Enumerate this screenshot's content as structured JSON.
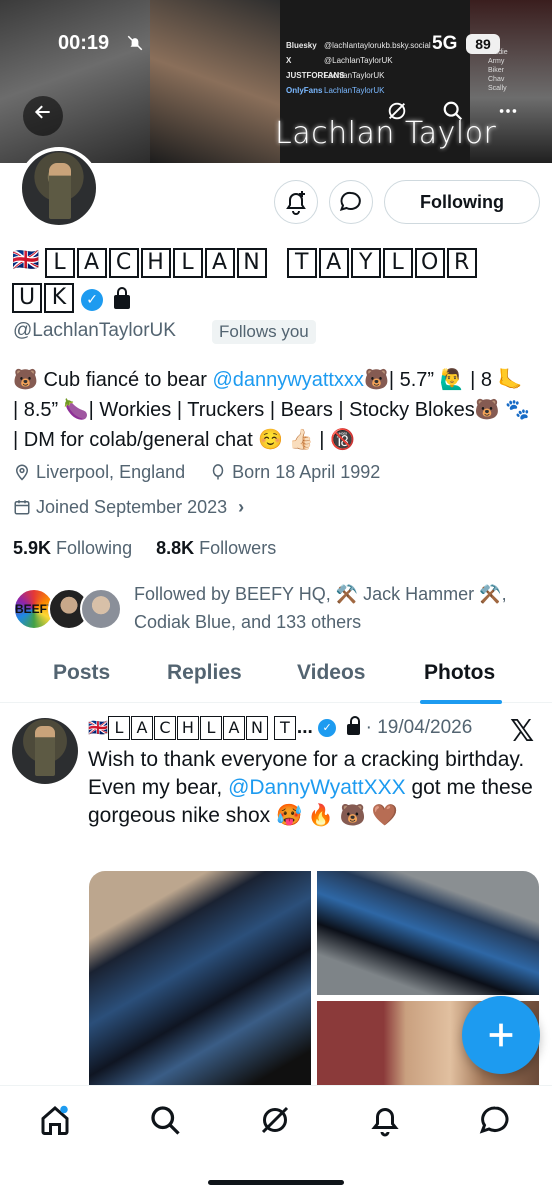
{
  "status_bar": {
    "time": "00:19",
    "network": "5G",
    "battery": "89"
  },
  "banner": {
    "title": "Lachlan Taylor",
    "socials": [
      {
        "tag": "Bluesky",
        "handle": "@lachlantaylorukb.bsky.social"
      },
      {
        "tag": "X",
        "handle": "@LachlanTaylorUK"
      },
      {
        "tag": "JUSTFORFANS",
        "handle": "LachlanTaylorUK"
      },
      {
        "tag": "OnlyFans",
        "handle": "LachlanTaylorUK"
      }
    ],
    "side_words": [
      "Tradie",
      "Army",
      "Biker",
      "Chav",
      "Scally"
    ]
  },
  "profile": {
    "name_letters_line1": [
      "L",
      "A",
      "C",
      "H",
      "L",
      "A",
      "N"
    ],
    "name_letters_line1b": [
      "T",
      "A",
      "Y",
      "L",
      "O",
      "R"
    ],
    "name_letters_line2": [
      "U",
      "K"
    ],
    "flag": "🇬🇧",
    "handle": "@LachlanTaylorUK",
    "follows_you": "Follows you",
    "follow_button": "Following",
    "bio_part1": "🐻 Cub fiancé to bear ",
    "bio_link": "@dannywyattxxx",
    "bio_part2": "🐻| 5.7” 🙋‍♂️ | 8 🦶 | 8.5” 🍆| Workies | Truckers | Bears | Stocky Blokes🐻 🐾 | DM for colab/general chat ☺️ 👍🏻 | 🔞",
    "location": "Liverpool, England",
    "born": "Born 18 April 1992",
    "joined": "Joined September 2023",
    "following_count": "5.9K",
    "following_label": "Following",
    "followers_count": "8.8K",
    "followers_label": "Followers",
    "followed_by": "Followed by BEEFY HQ, ⚒️ Jack Hammer ⚒️, Codiak Blue, and 133 others",
    "beefy_label": "BEEFY"
  },
  "tabs": [
    "Posts",
    "Replies",
    "Videos",
    "Photos"
  ],
  "active_tab": "Photos",
  "post": {
    "author_letters": [
      "L",
      "A",
      "C",
      "H",
      "L",
      "A",
      "N"
    ],
    "author_trunc_letter": "T",
    "ellipsis": "...",
    "date": "· 19/04/2026",
    "text_part1": "Wish to thank everyone for a cracking birthday. Even my bear, ",
    "text_link": "@DannyWyattXXX",
    "text_part2": " got me these gorgeous nike shox 🥵 🔥 🐻 🤎"
  },
  "colors": {
    "accent": "#1d9bf0",
    "text": "#0f1419",
    "secondary": "#536471"
  },
  "icons": {
    "back": "arrow-left-icon",
    "grok": "grok-icon",
    "search": "search-icon",
    "more": "more-icon",
    "notify": "bell-plus-icon",
    "message": "message-icon",
    "fab": "plus-icon"
  }
}
